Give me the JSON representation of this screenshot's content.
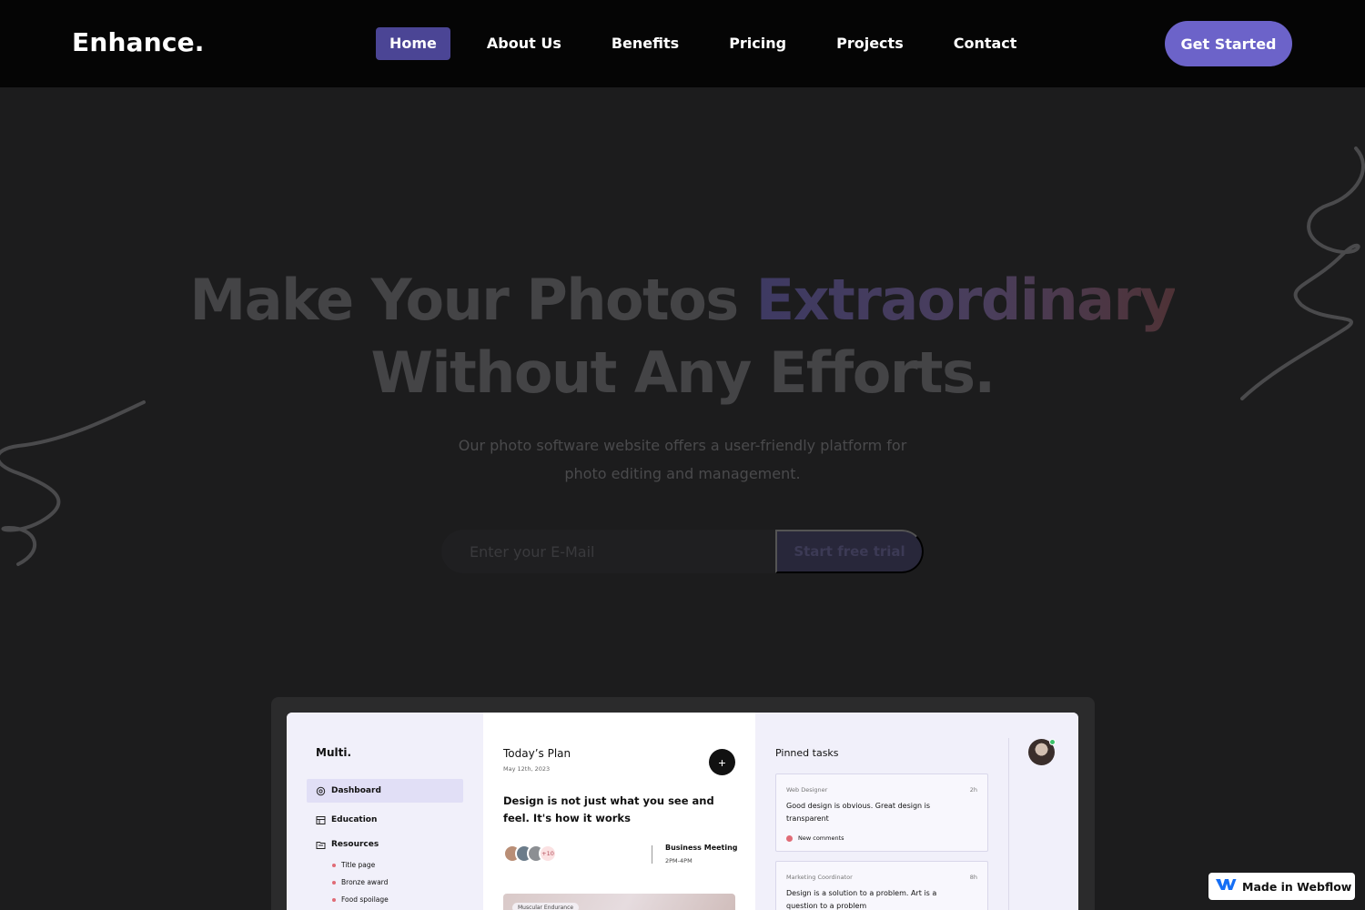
{
  "nav": {
    "logo": "Enhance.",
    "links": [
      {
        "label": "Home",
        "active": true
      },
      {
        "label": "About Us"
      },
      {
        "label": "Benefits"
      },
      {
        "label": "Pricing"
      },
      {
        "label": "Projects"
      },
      {
        "label": "Contact"
      }
    ],
    "cta_label": "Get Started"
  },
  "hero": {
    "title_part1": "Make Your Photos ",
    "title_highlight": "Extraordinary",
    "title_line2": "Without Any Efforts.",
    "subtitle": "Our photo software website offers a user-friendly platform for photo editing and management.",
    "email_placeholder": "Enter your E-Mail",
    "trial_label": "Start free trial"
  },
  "preview": {
    "app_logo": "Multi.",
    "sidebar": {
      "items": [
        {
          "label": "Dashboard",
          "icon": "dashboard-icon",
          "active": true
        },
        {
          "label": "Education",
          "icon": "education-icon"
        },
        {
          "label": "Resources",
          "icon": "resources-icon"
        }
      ],
      "sub_items": [
        "Title page",
        "Bronze award",
        "Food spoilage"
      ]
    },
    "plan": {
      "title": "Today’s Plan",
      "date": "May 12th, 2023",
      "quote": "Design is not just what you see and feel. It's how it works",
      "avatar_more": "+10",
      "meeting_title": "Business Meeting",
      "meeting_time": "2PM-4PM",
      "image_tag": "Muscular Endurance"
    },
    "pinned": {
      "title": "Pinned tasks",
      "tasks": [
        {
          "role": "Web Designer",
          "time": "2h",
          "text": "Good design is obvious. Great design is transparent",
          "meta": "New comments"
        },
        {
          "role": "Marketing Coordinator",
          "time": "8h",
          "text": "Design is a solution to a problem. Art is a question to a problem"
        }
      ]
    }
  },
  "badge": {
    "label": "Made in Webflow"
  },
  "colors": {
    "nav_bg": "#050505",
    "page_bg": "#1c1c1d",
    "accent": "#6c63c9",
    "active_link": "#4b4595"
  }
}
